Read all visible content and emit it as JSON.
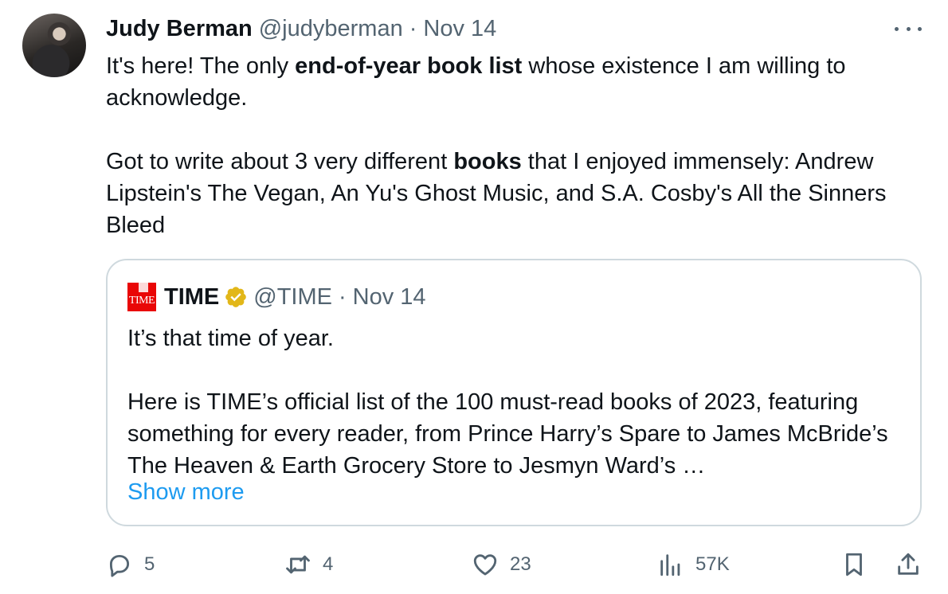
{
  "tweet": {
    "author_name": "Judy Berman",
    "handle": "@judyberman",
    "separator": "·",
    "date": "Nov 14",
    "text_part1": "It's here! The only ",
    "text_bold1": "end-of-year book list",
    "text_part2": " whose existence I am willing to acknowledge.\n\nGot to write about 3 very different ",
    "text_bold2": "books",
    "text_part3": " that I enjoyed immensely: Andrew Lipstein's The Vegan, An Yu's Ghost Music, and S.A. Cosby's All the Sinners Bleed",
    "more_icon": "more-horizontal-icon",
    "avatar_icon": "user-avatar"
  },
  "quote": {
    "logo_text": "TIME",
    "author_name": "TIME",
    "verified_icon": "gold-verified-badge-icon",
    "handle": "@TIME",
    "separator": "·",
    "date": "Nov 14",
    "text": "It’s that time of year.\n\nHere is TIME’s official list of the 100 must-read books of 2023, featuring something for every reader, from Prince Harry’s Spare to James McBride’s The Heaven & Earth Grocery Store to Jesmyn Ward’s …",
    "show_more": "Show more"
  },
  "actions": {
    "reply": {
      "icon": "reply-icon",
      "count": "5"
    },
    "retweet": {
      "icon": "retweet-icon",
      "count": "4"
    },
    "like": {
      "icon": "heart-icon",
      "count": "23"
    },
    "views": {
      "icon": "views-icon",
      "count": "57K"
    },
    "bookmark": {
      "icon": "bookmark-icon"
    },
    "share": {
      "icon": "share-icon"
    }
  },
  "colors": {
    "text": "#0f1419",
    "secondary": "#536471",
    "link": "#1d9bf0",
    "border": "#cfd9de",
    "time_red": "#e90606",
    "verified_gold": "#e2b719"
  }
}
